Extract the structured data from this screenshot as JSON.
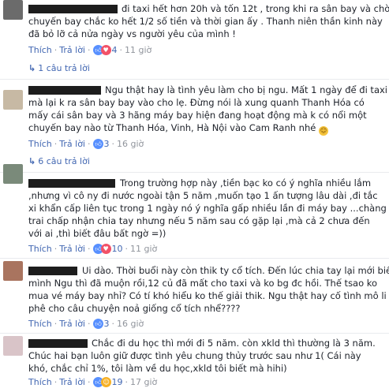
{
  "actions": {
    "like": "Thích",
    "reply": "Trả lời",
    "sep": "·"
  },
  "comments": [
    {
      "lines": [
        "đi taxi hết hơn 20h và tốn 12t , trong khi ra sân bay và chờ",
        "chuyến bay chắc ko hết 1/2 số tiền và thời gian ấy . Thanh niên thần kinh này",
        "đã bỏ lỡ cả nửa ngày vs người yêu của mình !"
      ],
      "reactions": "4",
      "time": "11 giờ",
      "reply_link": "1 câu trả lời"
    },
    {
      "lines": [
        "Ngu thật hay là tình yêu làm cho bị ngu. Mất 1 ngày để đi taxi",
        "mà lại k ra sân bay bay vào cho lẹ. Đừng nói là xung quanh Thanh Hóa có",
        "mấy cái sân bay và 3 hãng máy bay hiện đang hoạt động mà k có nổi một",
        "chuyến bay nào từ Thanh Hóa, Vinh, Hà Nội vào Cam Ranh nhé"
      ],
      "reactions": "3",
      "time": "16 giờ",
      "reply_link": "6 câu trả lời"
    },
    {
      "lines": [
        "Trong trường hợp này ,tiền bạc ko có ý nghĩa nhiều lắm",
        ",nhưng vì cô ny đi nước ngoài tận 5 năm ,muốn tạo 1 ấn tượng lâu dài ,đi tắc",
        "xi khẩn cấp liên tục trong 1 ngày nó ý nghĩa gấp nhiều lần đi máy bay ...chàng",
        "trai chấp nhận chia tay nhưng nếu 5 năm sau có gặp lại ,mà cả 2 chưa đến",
        "với ai ,thì biết đâu bất ngờ =))"
      ],
      "reactions": "10",
      "time": "11 giờ"
    },
    {
      "lines": [
        "Ui dào. Thời buổi này còn thik ty cổ tích. Đến lúc chia tay lại mới biết",
        "mình Ngu thì đã muộn rồi,12 củ đã mất cho taxi và ko bg đc hồi. Thế tsao ko",
        "mua vé máy bay nhỉ? Có tí khó hiểu ko thế giải thik. Ngu thật hay cố tình mô li",
        "phê cho câu chuyện noả giống cổ tích nhể????"
      ],
      "reactions": "3",
      "time": "16 giờ"
    },
    {
      "lines": [
        "Chắc đi du học thì mới đi 5 năm. còn xkld thì thường là 3 năm.",
        "Chúc hai bạn luôn giữ được tình yêu chung thủy trước sau như 1( Cái này",
        "khó, chắc chỉ 1%, tôi làm về du học,xkld tôi biết mà hihi)"
      ],
      "reactions": "19",
      "time": "17 giờ"
    }
  ]
}
